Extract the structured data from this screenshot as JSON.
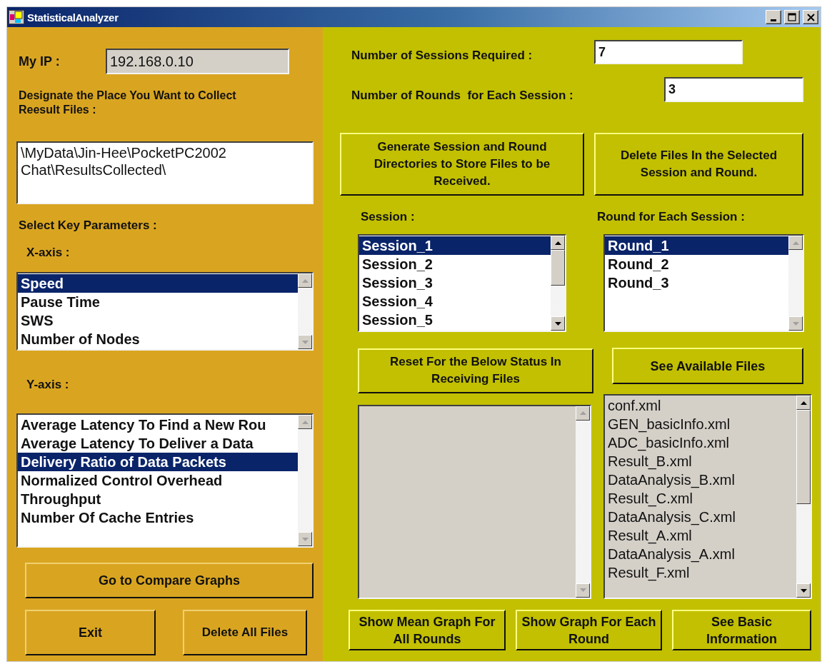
{
  "window": {
    "title": "StatisticalAnalyzer"
  },
  "ip": {
    "label": "My IP :",
    "value": "192.168.0.10"
  },
  "collect": {
    "label": "Designate the Place You Want to Collect Reesult Files :",
    "value": "\\MyData\\Jin-Hee\\PocketPC2002 Chat\\ResultsCollected\\"
  },
  "key_params_label": "Select Key Parameters :",
  "x_axis": {
    "label": "X-axis :",
    "items": [
      {
        "label": "Speed",
        "selected": true
      },
      {
        "label": "Pause Time",
        "selected": false
      },
      {
        "label": "SWS",
        "selected": false
      },
      {
        "label": "Number of Nodes",
        "selected": false
      }
    ]
  },
  "y_axis": {
    "label": "Y-axis :",
    "items": [
      {
        "label": "Average Latency To Find a New Rou",
        "selected": false
      },
      {
        "label": "Average Latency To Deliver a Data",
        "selected": false
      },
      {
        "label": "Delivery Ratio of Data Packets",
        "selected": true
      },
      {
        "label": "Normalized Control Overhead",
        "selected": false
      },
      {
        "label": "Throughput",
        "selected": false
      },
      {
        "label": "Number Of Cache Entries",
        "selected": false
      }
    ]
  },
  "left_buttons": {
    "compare": "Go to Compare Graphs",
    "exit": "Exit",
    "delete_all": "Delete All Files"
  },
  "sessions_required": {
    "label": "Number of Sessions Required :",
    "value": "7"
  },
  "rounds_per_session": {
    "label": "Number of Rounds  for Each Session :",
    "value": "3"
  },
  "generate_button": "Generate Session and Round Directories to Store Files to be Received.",
  "delete_selected_button": "Delete Files In the Selected Session and Round.",
  "session": {
    "label": "Session :",
    "items": [
      {
        "label": "Session_1",
        "selected": true
      },
      {
        "label": "Session_2",
        "selected": false
      },
      {
        "label": "Session_3",
        "selected": false
      },
      {
        "label": "Session_4",
        "selected": false
      },
      {
        "label": "Session_5",
        "selected": false
      }
    ]
  },
  "round": {
    "label": "Round for Each Session :",
    "items": [
      {
        "label": "Round_1",
        "selected": true
      },
      {
        "label": "Round_2",
        "selected": false
      },
      {
        "label": "Round_3",
        "selected": false
      }
    ]
  },
  "reset_button": "Reset For the Below Status In Receiving Files",
  "see_files_button": "See Available Files",
  "files": [
    "conf.xml",
    "GEN_basicInfo.xml",
    "ADC_basicInfo.xml",
    "Result_B.xml",
    "DataAnalysis_B.xml",
    "Result_C.xml",
    "DataAnalysis_C.xml",
    "Result_A.xml",
    "DataAnalysis_A.xml",
    "Result_F.xml"
  ],
  "bottom_buttons": [
    "Show Mean Graph For All Rounds",
    "Show Graph For Each Round",
    "See Basic Information"
  ]
}
